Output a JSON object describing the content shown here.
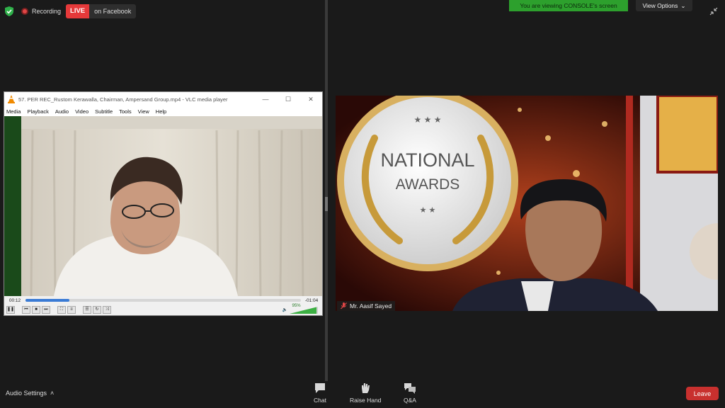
{
  "status": {
    "recording_label": "Recording",
    "live_label": "LIVE",
    "live_target": "on Facebook"
  },
  "share_banner": {
    "viewing_text": "You are viewing CONSOLE's screen",
    "view_options_label": "View Options"
  },
  "vlc": {
    "title": "57. PER REC_Rustom Kerawalla, Chairman, Ampersand Group.mp4 - VLC media player",
    "menu": [
      "Media",
      "Playback",
      "Audio",
      "Video",
      "Subtitle",
      "Tools",
      "View",
      "Help"
    ],
    "elapsed": "00:12",
    "remaining": "-01:04",
    "progress": 0.16,
    "volume_label": "95%",
    "volume": 0.95
  },
  "participant": {
    "name": "Mr. Aasif Sayed",
    "banner_line1": "NATIONAL",
    "banner_line2": "AWARDS"
  },
  "toolbar": {
    "audio_settings_label": "Audio Settings",
    "chat_label": "Chat",
    "raise_hand_label": "Raise Hand",
    "qa_label": "Q&A",
    "leave_label": "Leave"
  },
  "colors": {
    "live_red": "#e5393a",
    "share_green": "#2da02d",
    "leave_red": "#c8302e"
  }
}
